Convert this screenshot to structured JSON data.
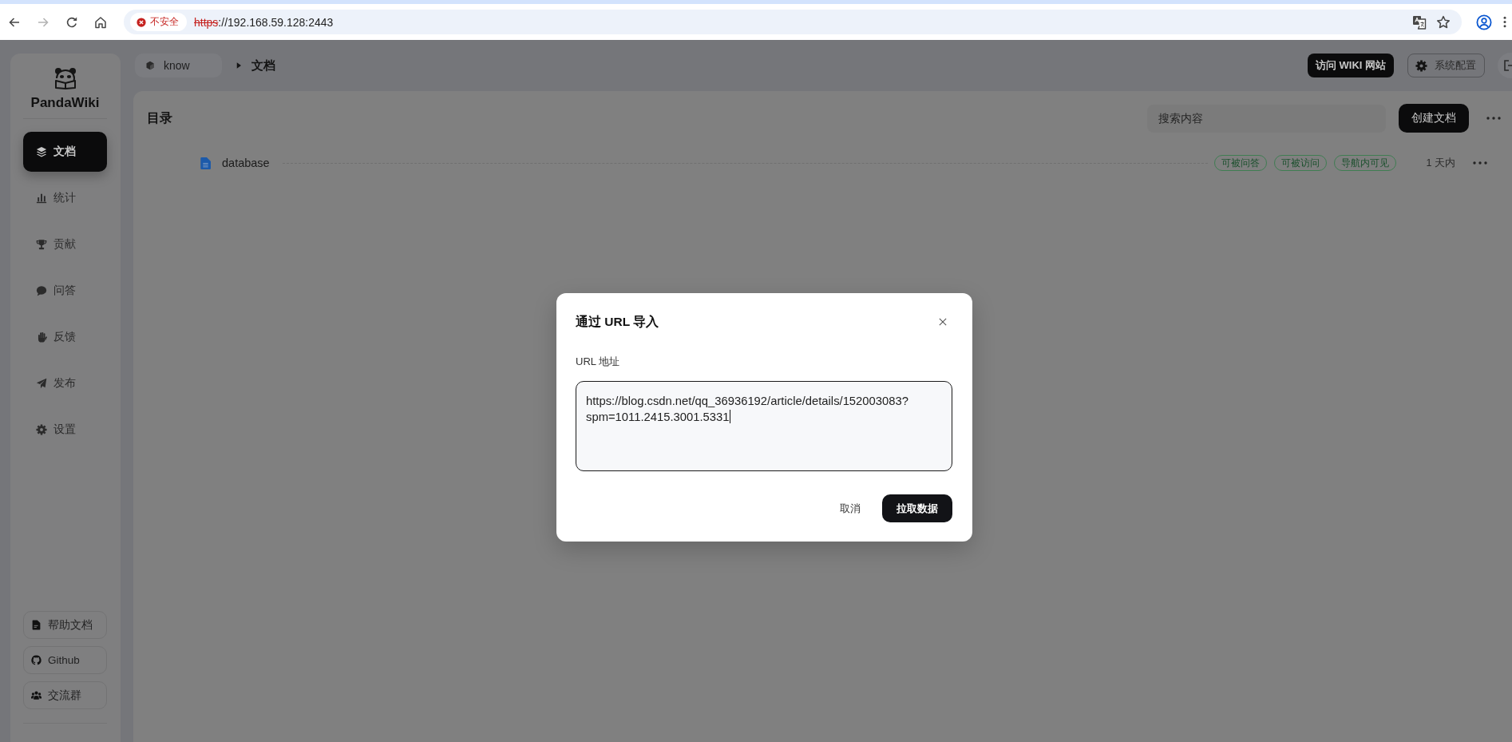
{
  "browser": {
    "security_label": "不安全",
    "url_scheme": "https",
    "url_rest": "://192.168.59.128:2443",
    "insecure": true
  },
  "sidebar": {
    "brand": "PandaWiki",
    "nav": [
      {
        "label": "文档",
        "selected": true
      },
      {
        "label": "统计",
        "selected": false
      },
      {
        "label": "贡献",
        "selected": false
      },
      {
        "label": "问答",
        "selected": false
      },
      {
        "label": "反馈",
        "selected": false
      },
      {
        "label": "发布",
        "selected": false
      },
      {
        "label": "设置",
        "selected": false
      }
    ],
    "links": [
      {
        "label": "帮助文档"
      },
      {
        "label": "Github"
      },
      {
        "label": "交流群"
      }
    ]
  },
  "header": {
    "space": "know",
    "page": "文档",
    "buttons": [
      {
        "label": "访问 WIKI 网站",
        "kind": "primary"
      },
      {
        "label": "系统配置",
        "kind": "outline"
      }
    ]
  },
  "catalog": {
    "title": "目录",
    "search": {
      "placeholder": "搜索内容"
    },
    "create_button": "创建文档",
    "items": [
      {
        "name": "database",
        "tags": [
          "可被问答",
          "可被访问",
          "导航内可见"
        ],
        "updated": "1 天内"
      }
    ]
  },
  "dialog": {
    "title": "通过 URL 导入",
    "field": {
      "label": "URL 地址",
      "value": "https://blog.csdn.net/qq_36936192/article/details/152003083?spm=1011.2415.3001.5331",
      "focused": true
    },
    "buttons": [
      {
        "label": "取消",
        "kind": "text"
      },
      {
        "label": "拉取数据",
        "kind": "primary"
      }
    ]
  }
}
